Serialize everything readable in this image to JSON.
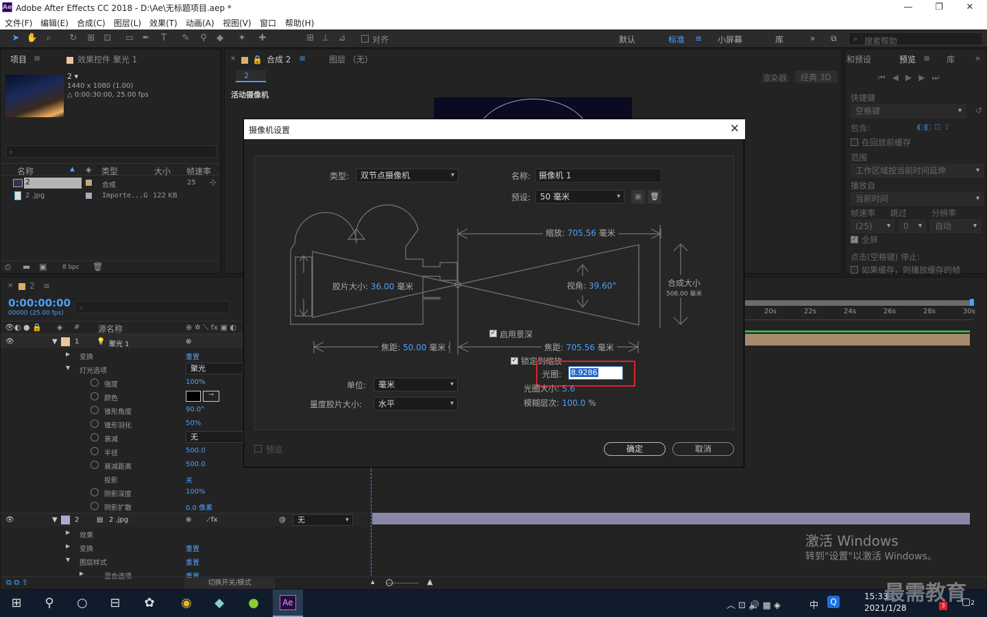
{
  "titlebar": {
    "icon": "Ae",
    "title": "Adobe After Effects CC 2018 - D:\\Ae\\无标题项目.aep *",
    "min": "—",
    "max": "❐",
    "close": "✕"
  },
  "menu": [
    "文件(F)",
    "编辑(E)",
    "合成(C)",
    "图层(L)",
    "效果(T)",
    "动画(A)",
    "视图(V)",
    "窗口",
    "帮助(H)"
  ],
  "toolbar": {
    "align_label": "对齐",
    "workspaces": [
      "默认",
      "标准",
      "小屏幕",
      "库"
    ],
    "active_workspace": "标准",
    "search_placeholder": "搜索帮助"
  },
  "project": {
    "tab": "项目",
    "effects_tab": "效果控件 聚光 1",
    "comp_name": "2 ▾",
    "comp_info1": "1440 x 1080 (1.00)",
    "comp_info2": "△ 0:00:30:00, 25.00 fps",
    "headers": [
      "名称",
      "类型",
      "大小",
      "帧速率"
    ],
    "rows": [
      {
        "name": "2",
        "type": "合成",
        "size": "",
        "fps": "25"
      },
      {
        "name": "2 .jpg",
        "type": "Importe...G",
        "size": "122 KB",
        "fps": ""
      }
    ],
    "bpc": "8 bpc"
  },
  "comp": {
    "tab": "合成 2",
    "layer_tab": "图层 （无）",
    "sub_tab": "2",
    "renderer_label": "渲染器:",
    "renderer": "经典 3D",
    "camera_label": "活动摄像机"
  },
  "preview": {
    "tab1": "和预设",
    "tab2": "预览",
    "tab3": "库",
    "shortcut_label": "快捷键",
    "shortcut_value": "空格键",
    "include_label": "包含:",
    "cache_label": "在回放前缓存",
    "range_label": "范围",
    "range_value": "工作区域按当前时间延伸",
    "play_from_label": "播放自",
    "play_from_value": "当前时间",
    "fps_label": "帧速率",
    "skip_label": "跳过",
    "res_label": "分辨率",
    "fps_value": "(25)",
    "skip_value": "0",
    "res_value": "自动",
    "fullscreen_label": "全屏",
    "stop_label": "点击(空格键) 停止:",
    "ifcache_label": "如果缓存，则播放缓存的帧"
  },
  "dialog": {
    "title": "摄像机设置",
    "type_label": "类型:",
    "type_value": "双节点摄像机",
    "name_label": "名称:",
    "name_value": "摄像机 1",
    "preset_label": "预设:",
    "preset_value": "50 毫米",
    "zoom_label": "缩放:",
    "zoom_value": "705.56",
    "zoom_unit": "毫米",
    "film_label": "胶片大小:",
    "film_value": "36.00",
    "film_unit": "毫米",
    "angle_label": "视角:",
    "angle_value": "39.60",
    "angle_unit": "°",
    "comp_size_label": "合成大小",
    "comp_size_value": "508.00 毫米",
    "dof_label": "启用景深",
    "focal_label": "焦距:",
    "focal_value": "50.00",
    "focal_unit": "毫米",
    "focus_dist_label": "焦距:",
    "focus_dist_value": "705.56",
    "focus_dist_unit": "毫米",
    "lock_label": "锁定到缩放",
    "aperture_label": "光圈:",
    "aperture_value": "8.9286",
    "fstop_label": "光圈大小:",
    "fstop_value": "5.6",
    "blur_label": "模糊层次:",
    "blur_value": "100.0",
    "blur_unit": "%",
    "unit_label": "单位:",
    "unit_value": "毫米",
    "measure_label": "量度胶片大小:",
    "measure_value": "水平",
    "preview_label": "预览",
    "ok": "确定",
    "cancel": "取消"
  },
  "timeline": {
    "tab": "2",
    "timecode": "0:00:00:00",
    "frames": "00000 (25.00 fps)",
    "col_source": "源名称",
    "ruler": [
      "20s",
      "22s",
      "24s",
      "26s",
      "28s",
      "30s"
    ],
    "layers": [
      {
        "num": "1",
        "name": "聚光 1",
        "kind": "light"
      },
      {
        "l": "变换",
        "v": "重置",
        "indent": 1
      },
      {
        "l": "灯光选项",
        "v": "聚光",
        "indent": 1
      },
      {
        "l": "强度",
        "v": "100%",
        "indent": 2
      },
      {
        "l": "颜色",
        "v": "",
        "indent": 2
      },
      {
        "l": "锥形角度",
        "v": "90.0°",
        "indent": 2
      },
      {
        "l": "锥形羽化",
        "v": "50%",
        "indent": 2
      },
      {
        "l": "衰减",
        "v": "无",
        "indent": 2
      },
      {
        "l": "半径",
        "v": "500.0",
        "indent": 2
      },
      {
        "l": "衰减距离",
        "v": "500.0",
        "indent": 2
      },
      {
        "l": "投影",
        "v": "关",
        "indent": 2
      },
      {
        "l": "阴影深度",
        "v": "100%",
        "indent": 2
      },
      {
        "l": "阴影扩散",
        "v": "0.0 像素",
        "indent": 2
      },
      {
        "num": "2",
        "name": "2 .jpg",
        "kind": "image",
        "mode": "无"
      },
      {
        "l": "效果",
        "v": "",
        "indent": 1
      },
      {
        "l": "变换",
        "v": "重置",
        "indent": 1
      },
      {
        "l": "图层样式",
        "v": "重置",
        "indent": 1
      },
      {
        "l": "混合选项",
        "v": "重置",
        "indent": 2
      }
    ],
    "footer": "切换开关/模式"
  },
  "watermark": {
    "line1": "激活 Windows",
    "line2": "转到\"设置\"以激活 Windows。",
    "brand": "最需教育"
  },
  "taskbar": {
    "time": "15:33",
    "date": "2021/1/28",
    "ime": "中",
    "badge": "3",
    "notif": "2"
  }
}
